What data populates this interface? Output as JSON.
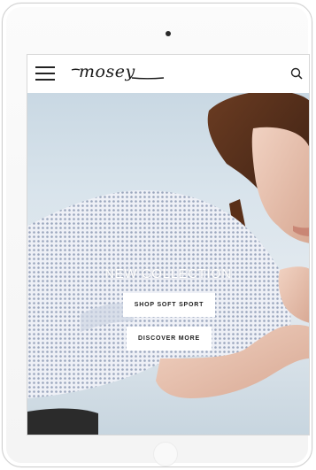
{
  "header": {
    "logo_text": "mosey",
    "menu_icon": "hamburger-menu-icon",
    "search_icon": "search-icon"
  },
  "hero": {
    "title": "NEW COLLECTION",
    "primary_button": "SHOP SOFT SPORT",
    "secondary_button": "DISCOVER MORE"
  },
  "device": {
    "frame": "tablet",
    "camera_icon": "camera-icon",
    "home_button_icon": "home-button-icon"
  },
  "colors": {
    "background": "#ffffff",
    "text_dark": "#1d1d1d",
    "sky": "#d9e4ec",
    "button_bg": "#ffffff"
  }
}
